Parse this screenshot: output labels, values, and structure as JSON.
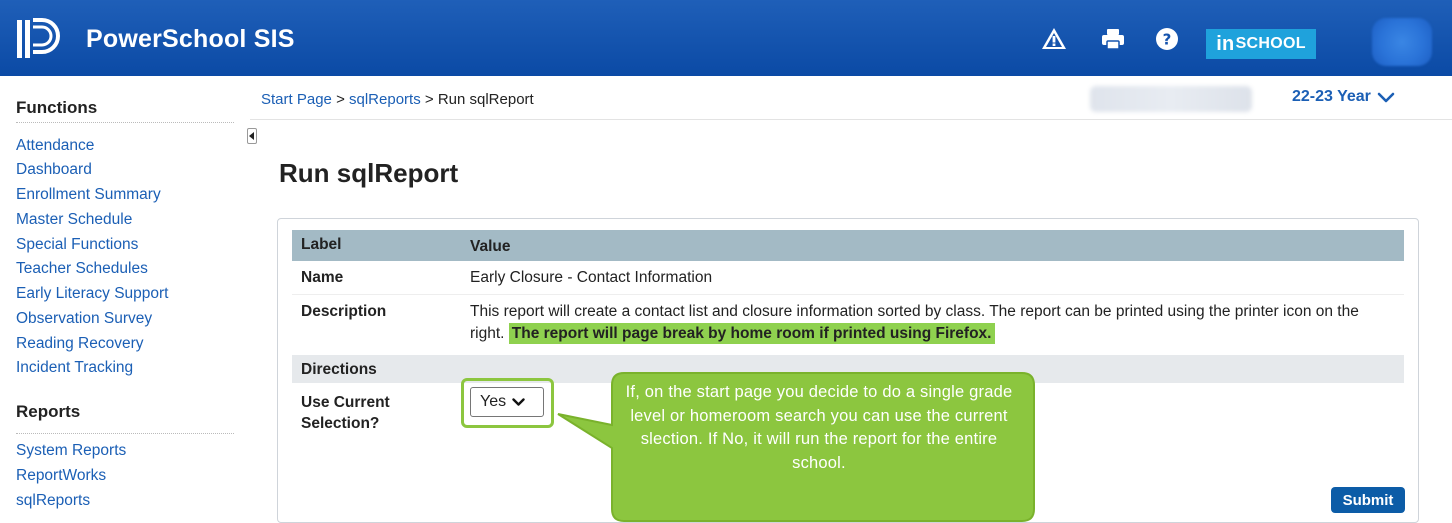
{
  "app": {
    "title": "PowerSchool SIS",
    "inschool_in": "in",
    "inschool_rest": "SCHOOL",
    "icons": [
      "alert-triangle-icon",
      "printer-icon",
      "help-icon"
    ]
  },
  "sidebar": {
    "functions_heading": "Functions",
    "functions": [
      "Attendance",
      "Dashboard",
      "Enrollment Summary",
      "Master Schedule",
      "Special Functions",
      "Teacher Schedules",
      "Early Literacy Support",
      "Observation Survey",
      "Reading Recovery",
      "Incident Tracking"
    ],
    "reports_heading": "Reports",
    "reports": [
      "System Reports",
      "ReportWorks",
      "sqlReports"
    ]
  },
  "breadcrumb": {
    "items": [
      "Start Page",
      "sqlReports"
    ],
    "separator": ">",
    "current": "Run sqlReport"
  },
  "year_selector": {
    "label": "22-23 Year"
  },
  "page": {
    "title": "Run sqlReport"
  },
  "report": {
    "header_label": "Label",
    "header_value": "Value",
    "name_label": "Name",
    "name_value": "Early Closure - Contact Information",
    "description_label": "Description",
    "description_text": "This report will create a contact list and closure information sorted by class. The report can be printed using the printer icon on the right.",
    "description_highlight": "The report will page break by home room if printed using Firefox.",
    "directions_label": "Directions",
    "selection_label_line1": "Use Current",
    "selection_label_line2": "Selection?",
    "selection_value": "Yes",
    "submit_label": "Submit"
  },
  "callout": {
    "text": "If, on the start page you decide to do a single grade level or homeroom search you can use the current slection. If No, it will run the report for the entire school."
  },
  "colors": {
    "header_blue": "#0b4aa5",
    "link_blue": "#1b5fb5",
    "table_header": "#a3bac5",
    "callout_green": "#8cc63f",
    "highlight_green": "#8fd14f",
    "inschool_cyan": "#1fa2dc",
    "submit_blue": "#0c5ca7"
  }
}
